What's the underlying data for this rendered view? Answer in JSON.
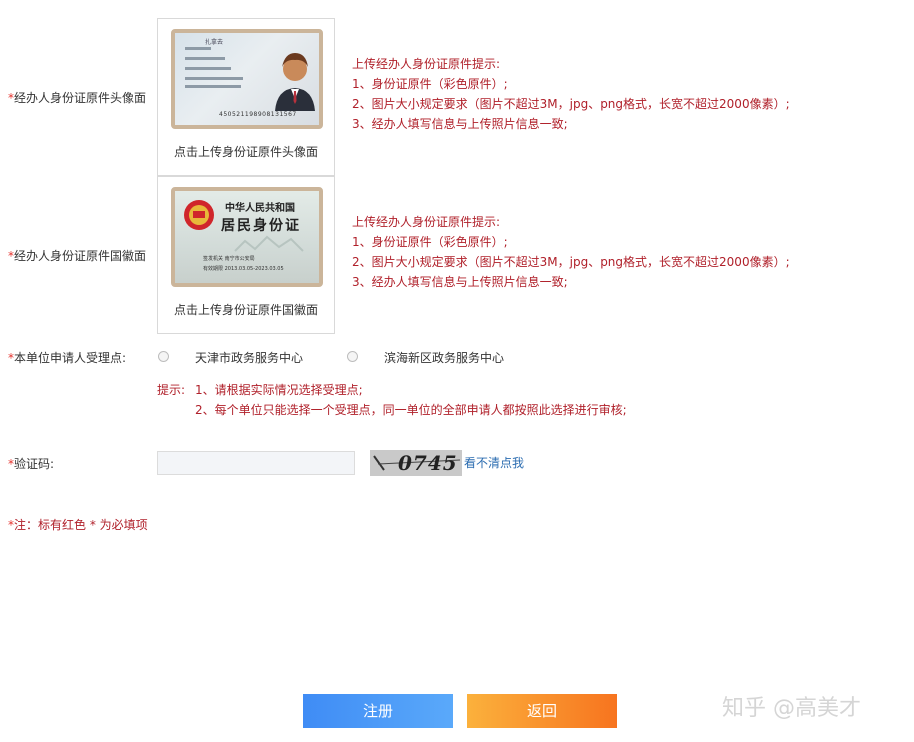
{
  "head_upload": {
    "label": "经办人身份证原件头像面",
    "caption": "点击上传身份证原件头像面",
    "card_number": "450521198908131567",
    "card_name": "扎拿去",
    "hint_lines": [
      "上传经办人身份证原件提示:",
      "1、身份证原件（彩色原件）;",
      "2、图片大小规定要求（图片不超过3M，jpg、png格式，长宽不超过2000像素）;",
      "3、经办人填写信息与上传照片信息一致;"
    ]
  },
  "emblem_upload": {
    "label": "经办人身份证原件国徽面",
    "caption": "点击上传身份证原件国徽面",
    "card_title1": "中华人民共和国",
    "card_title2": "居民身份证",
    "card_line1": "签发机关  南宁市公安局",
    "card_line2": "有效期限  2013.03.05-2023.03.05",
    "hint_lines": [
      "上传经办人身份证原件提示:",
      "1、身份证原件（彩色原件）;",
      "2、图片大小规定要求（图片不超过3M，jpg、png格式，长宽不超过2000像素）;",
      "3、经办人填写信息与上传照片信息一致;"
    ]
  },
  "acceptance": {
    "label": "本单位申请人受理点:",
    "options": [
      "天津市政务服务中心",
      "滨海新区政务服务中心"
    ],
    "tip_prefix": "提示:",
    "tip_lines": [
      "1、请根据实际情况选择受理点;",
      "2、每个单位只能选择一个受理点，同一单位的全部申请人都按照此选择进行审核;"
    ]
  },
  "captcha": {
    "label": "验证码:",
    "image_text": "0745",
    "refresh_link": "看不清点我"
  },
  "note": "注：标有红色 * 为必填项",
  "required_mark": "*",
  "buttons": {
    "register": "注册",
    "back": "返回"
  },
  "watermark": "知乎 @高美才",
  "colors": {
    "required": "#e5322d",
    "hint": "#b0202a",
    "link": "#2b6cb0",
    "register_gradient": [
      "#3f8cf5",
      "#5aa9fa"
    ],
    "back_gradient": [
      "#fbb13c",
      "#f7741f"
    ]
  }
}
